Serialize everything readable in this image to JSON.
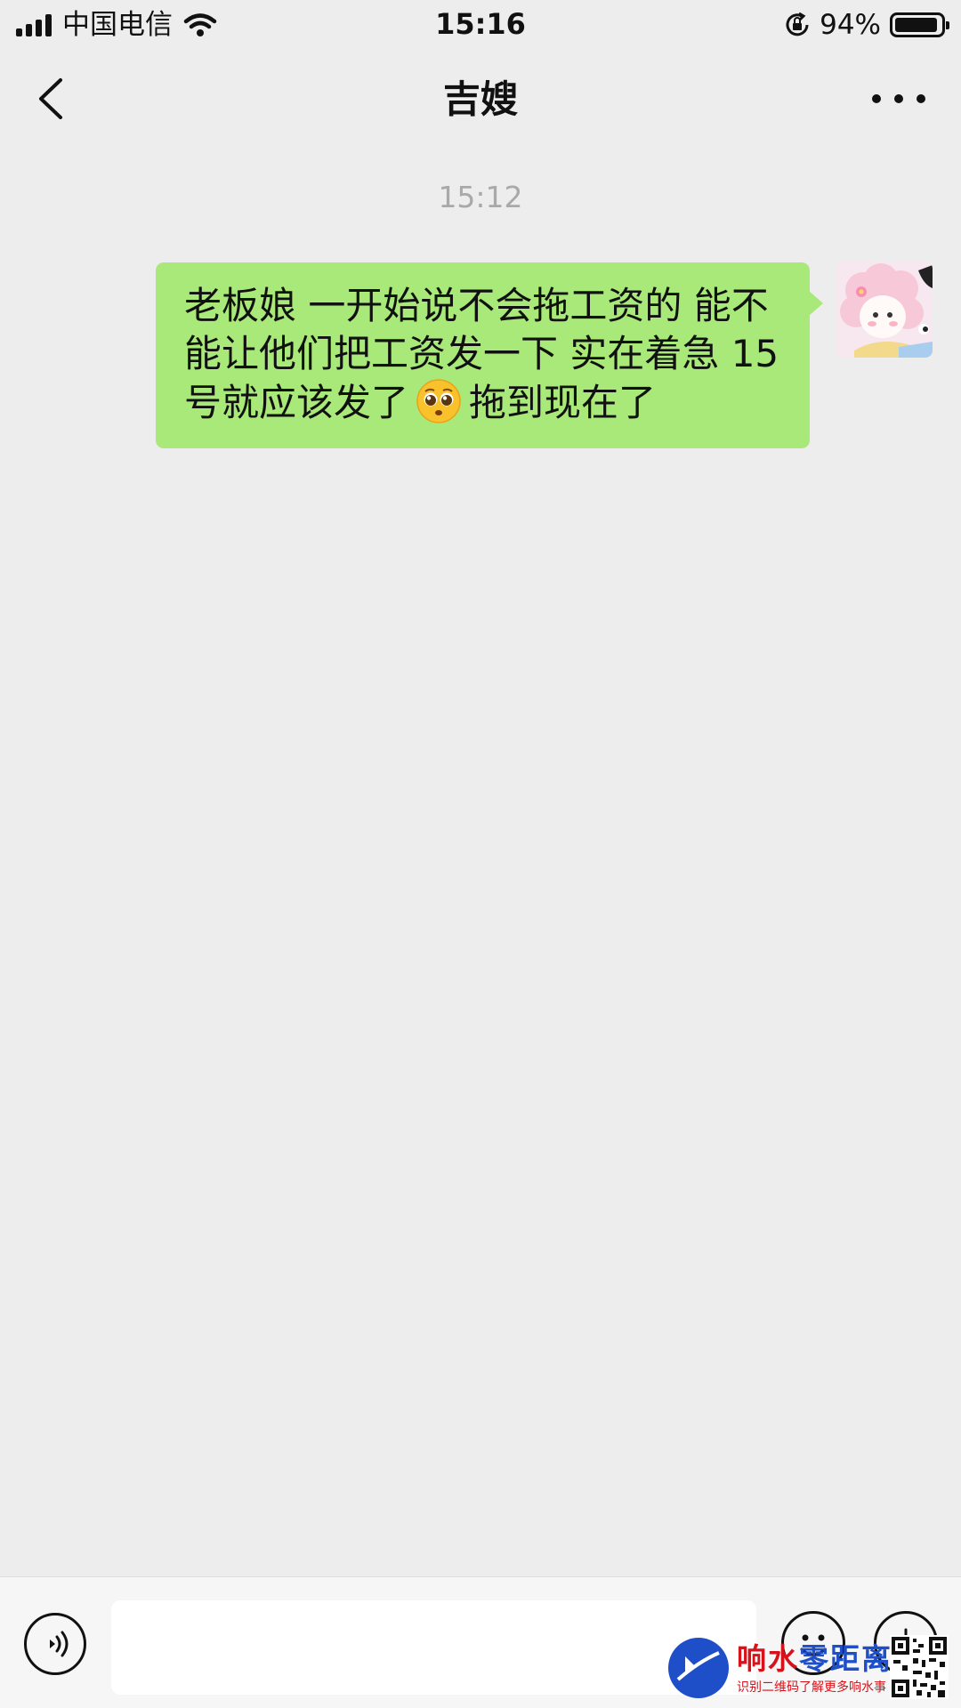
{
  "status_bar": {
    "carrier": "中国电信",
    "time": "15:16",
    "battery_text": "94%",
    "battery_level": 0.94,
    "icons": [
      "signal-icon",
      "wifi-icon",
      "orientation-lock-icon",
      "battery-icon"
    ]
  },
  "nav": {
    "title": "吉嫂",
    "back_icon": "chevron-left-icon",
    "more_icon": "more-dots-icon"
  },
  "messages": [
    {
      "time": "15:12",
      "sender": "self",
      "text_before_emoji": "老板娘 一开始说不会拖工资的 能不能让他们把工资发一下 实在着急 15号就应该发了",
      "emoji": "pleading-face-emoji",
      "text_after_emoji": "拖到现在了",
      "bubble_color": "#a9e97a"
    }
  ],
  "input_bar": {
    "voice_icon": "voice-icon",
    "text_value": "",
    "emoji_icon": "smiley-icon",
    "plus_icon": "plus-icon"
  },
  "watermark": {
    "title_part1": "响水",
    "title_part2": "零距离",
    "subtitle": "识别二维码了解更多响水事"
  },
  "colors": {
    "background": "#ededed",
    "bubble": "#a9e97a",
    "timestamp": "#a9a9a9"
  }
}
